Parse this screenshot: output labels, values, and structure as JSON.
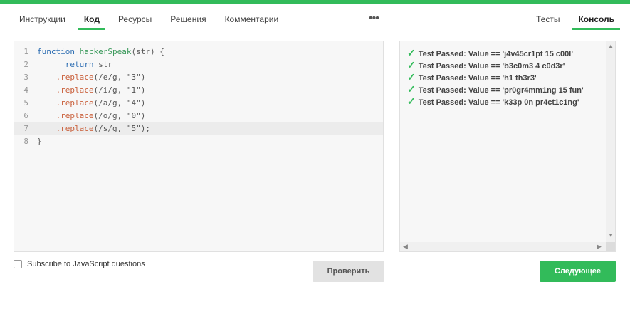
{
  "tabs_left": [
    "Инструкции",
    "Код",
    "Ресурсы",
    "Решения",
    "Комментарии"
  ],
  "active_left": "Код",
  "more_label": "•••",
  "tabs_right": [
    "Тесты",
    "Консоль"
  ],
  "active_right": "Консоль",
  "editor": {
    "line_numbers": [
      "1",
      "2",
      "3",
      "4",
      "5",
      "6",
      "7",
      "8"
    ],
    "lines": [
      [
        {
          "t": "function",
          "c": "kw"
        },
        {
          "t": " ",
          "c": ""
        },
        {
          "t": "hackerSpeak",
          "c": "fn"
        },
        {
          "t": "(str) {",
          "c": ""
        }
      ],
      [
        {
          "t": "      ",
          "c": ""
        },
        {
          "t": "return",
          "c": "kw"
        },
        {
          "t": " str",
          "c": ""
        }
      ],
      [
        {
          "t": "    ",
          "c": ""
        },
        {
          "t": ".replace",
          "c": "mth"
        },
        {
          "t": "(/e/g, \"3\")",
          "c": ""
        }
      ],
      [
        {
          "t": "    ",
          "c": ""
        },
        {
          "t": ".replace",
          "c": "mth"
        },
        {
          "t": "(/i/g, \"1\")",
          "c": ""
        }
      ],
      [
        {
          "t": "    ",
          "c": ""
        },
        {
          "t": ".replace",
          "c": "mth"
        },
        {
          "t": "(/a/g, \"4\")",
          "c": ""
        }
      ],
      [
        {
          "t": "    ",
          "c": ""
        },
        {
          "t": ".replace",
          "c": "mth"
        },
        {
          "t": "(/o/g, \"0\")",
          "c": ""
        }
      ],
      [
        {
          "t": "    ",
          "c": ""
        },
        {
          "t": ".replace",
          "c": "mth"
        },
        {
          "t": "(/s/g, \"5\");",
          "c": ""
        }
      ],
      [
        {
          "t": "}",
          "c": ""
        }
      ]
    ],
    "highlighted_line": 7
  },
  "console": {
    "check_icon": "✓",
    "lines": [
      "Test Passed: Value == 'j4v45cr1pt 15 c00l'",
      "Test Passed: Value == 'b3c0m3 4 c0d3r'",
      "Test Passed: Value == 'h1 th3r3'",
      "Test Passed: Value == 'pr0gr4mm1ng 15 fun'",
      "Test Passed: Value == 'k33p 0n pr4ct1c1ng'"
    ]
  },
  "subscribe_label": "Subscribe to JavaScript questions",
  "check_button": "Проверить",
  "next_button": "Следующее",
  "colors": {
    "accent": "#32bb5a",
    "keyword": "#2f6fb3",
    "function_name": "#3c9a5c",
    "method": "#c95f3a"
  }
}
